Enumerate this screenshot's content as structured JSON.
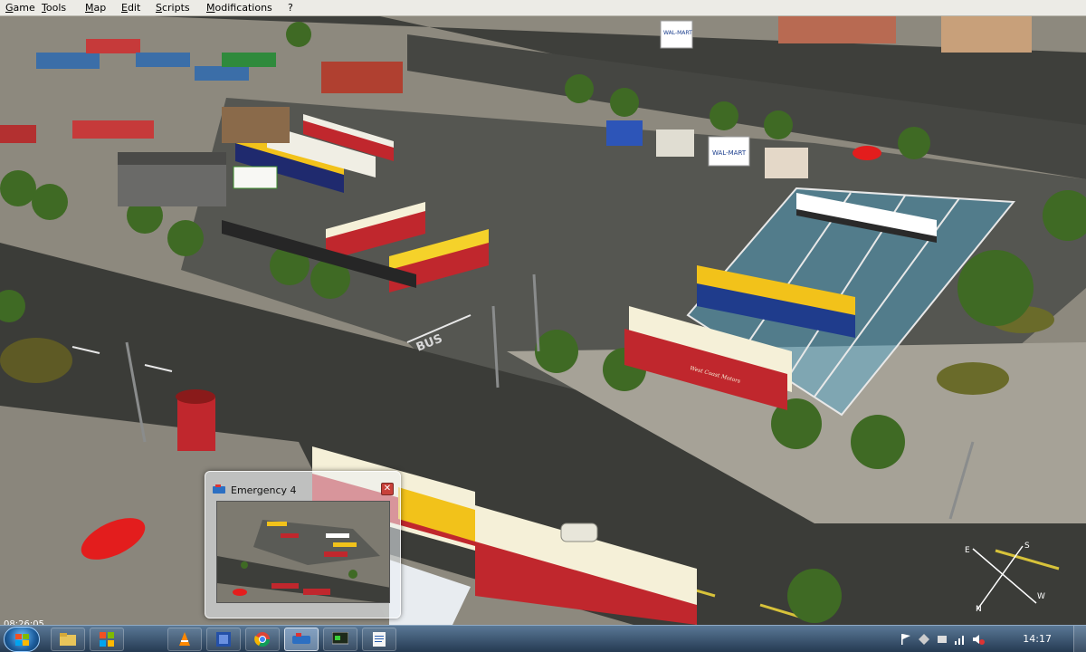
{
  "menu": {
    "game": "Game",
    "tools": "Tools",
    "map": "Map",
    "edit": "Edit",
    "scripts": "Scripts",
    "modifications": "Modifications",
    "help": "?"
  },
  "scene": {
    "road_marking": "BUS",
    "bus_livery": "West Coast Motors",
    "billboard_1": "WAL-MART",
    "billboard_2": "WAL-MART"
  },
  "compass": {
    "s": "S",
    "e": "E",
    "n": "N",
    "w": "W"
  },
  "thumbnail": {
    "title": "Emergency 4",
    "close": "✕"
  },
  "game_time": "08:26:05",
  "taskbar": {
    "clock": "14:17",
    "items": [
      "explorer",
      "windows-media",
      "vlc",
      "app-blue",
      "chrome",
      "emergency-4",
      "terminal",
      "notepad"
    ]
  },
  "colors": {
    "menubar": "#ecebe6",
    "taskbar_top": "#5a7896",
    "taskbar_bottom": "#253a52",
    "bus_red": "#c0272d",
    "bus_yellow": "#f2c21a",
    "bus_cream": "#f5f0d8"
  }
}
